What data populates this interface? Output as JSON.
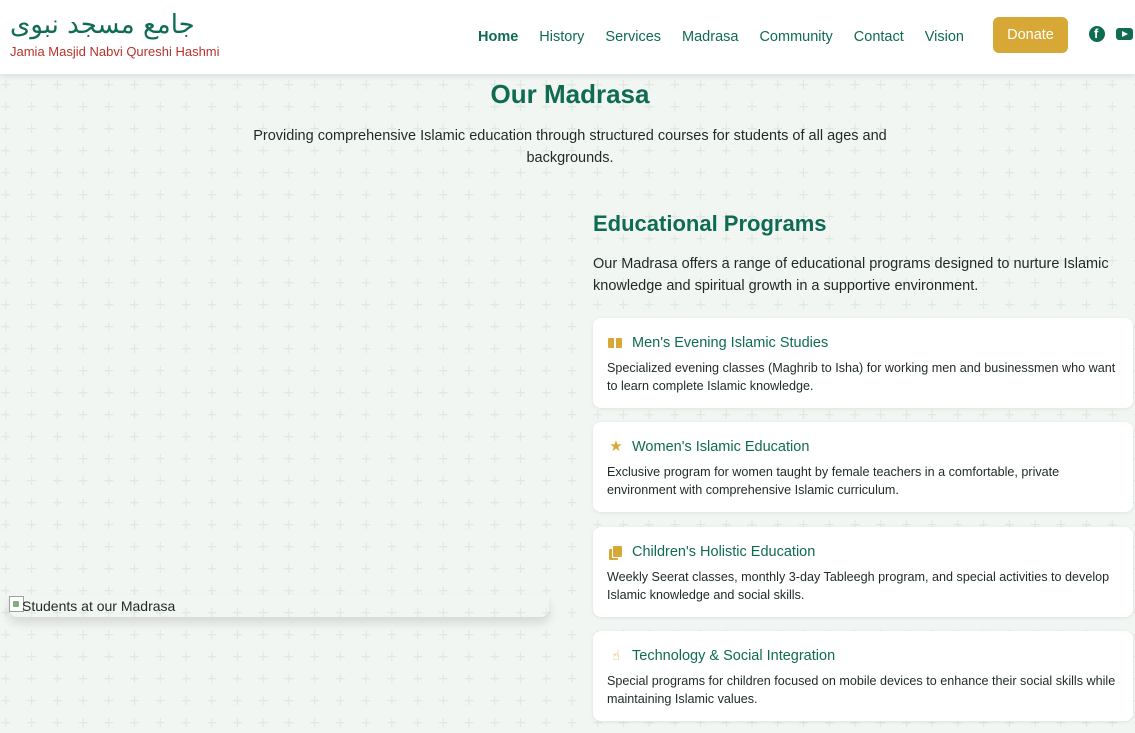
{
  "header": {
    "brand_urdu": "جامع مسجد نبوی",
    "brand_sub": "Jamia Masjid Nabvi Qureshi Hashmi",
    "nav": [
      "Home",
      "History",
      "Services",
      "Madrasa",
      "Community",
      "Contact",
      "Vision"
    ],
    "donate_label": "Donate",
    "social": [
      "facebook-icon",
      "youtube-icon"
    ]
  },
  "hero": {
    "title": "Our Madrasa",
    "subtitle": "Providing comprehensive Islamic education through structured courses for students of all ages and backgrounds."
  },
  "image": {
    "alt": "Students at our Madrasa"
  },
  "programs": {
    "title": "Educational Programs",
    "description": "Our Madrasa offers a range of educational programs designed to nurture Islamic knowledge and spiritual growth in a supportive environment.",
    "items": [
      {
        "icon": "book-icon",
        "title": "Men's Evening Islamic Studies",
        "text": "Specialized evening classes (Maghrib to Isha) for working men and businessmen who want to learn complete Islamic knowledge."
      },
      {
        "icon": "star-icon",
        "title": "Women's Islamic Education",
        "text": "Exclusive program for women taught by female teachers in a comfortable, private environment with comprehensive Islamic curriculum."
      },
      {
        "icon": "copy-icon",
        "title": "Children's Holistic Education",
        "text": "Weekly Seerat classes, monthly 3-day Tableegh program, and special activities to develop Islamic knowledge and social skills."
      },
      {
        "icon": "hand-icon",
        "title": "Technology & Social Integration",
        "text": "Special programs for children focused on mobile devices to enhance their social skills while maintaining Islamic values."
      }
    ]
  },
  "colors": {
    "primary": "#0f6b52",
    "accent": "#d8a836",
    "brand_sub": "#b6332d",
    "background": "#f2f6f3"
  }
}
